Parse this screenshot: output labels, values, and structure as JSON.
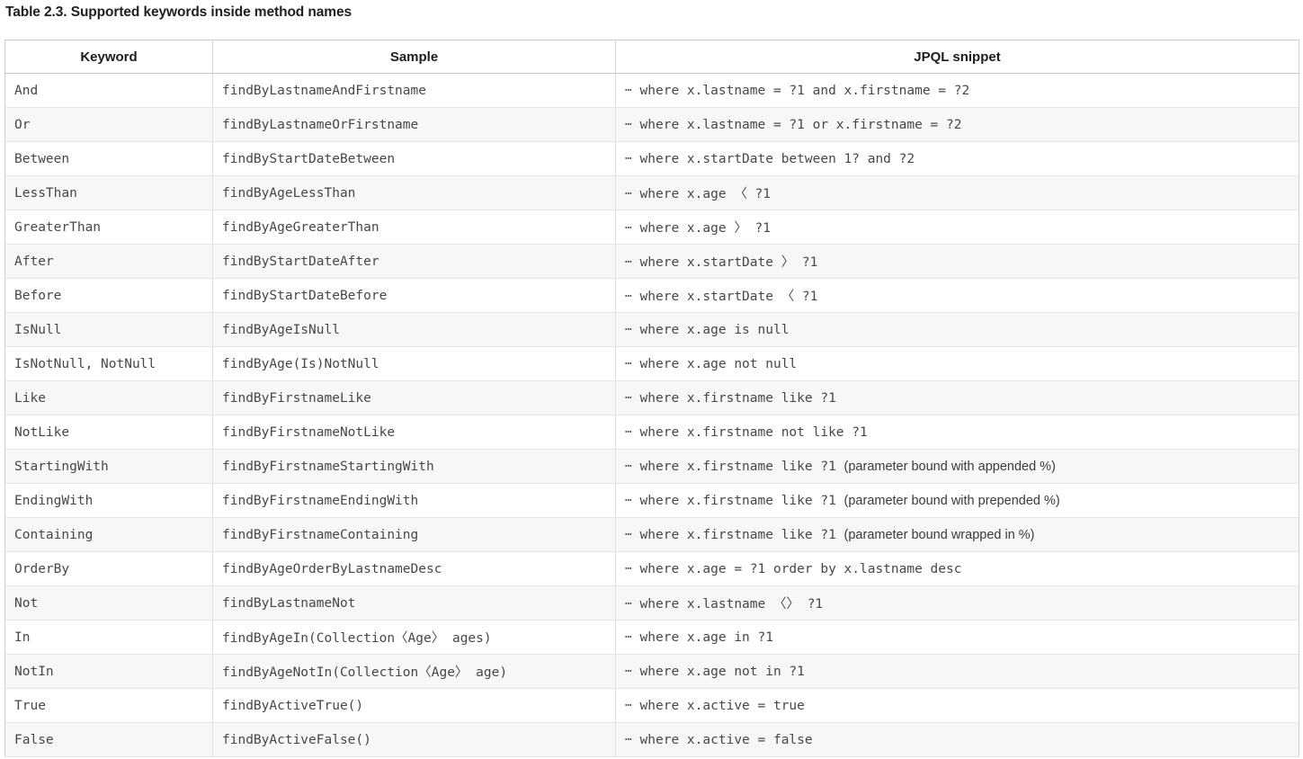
{
  "caption": "Table 2.3. Supported keywords inside method names",
  "table": {
    "columns": [
      {
        "key": "keyword",
        "label": "Keyword"
      },
      {
        "key": "sample",
        "label": "Sample"
      },
      {
        "key": "jpql",
        "label": "JPQL snippet"
      }
    ],
    "ellipsis": "⋯",
    "rows": [
      {
        "keyword": "And",
        "sample": "findByLastnameAndFirstname",
        "jpql_code": " where x.lastname = ?1 and x.firstname = ?2",
        "jpql_note": ""
      },
      {
        "keyword": "Or",
        "sample": "findByLastnameOrFirstname",
        "jpql_code": " where x.lastname = ?1 or x.firstname = ?2",
        "jpql_note": ""
      },
      {
        "keyword": "Between",
        "sample": "findByStartDateBetween",
        "jpql_code": " where x.startDate between 1? and ?2",
        "jpql_note": ""
      },
      {
        "keyword": "LessThan",
        "sample": "findByAgeLessThan",
        "jpql_code": " where x.age 〈 ?1",
        "jpql_note": ""
      },
      {
        "keyword": "GreaterThan",
        "sample": "findByAgeGreaterThan",
        "jpql_code": " where x.age 〉 ?1",
        "jpql_note": ""
      },
      {
        "keyword": "After",
        "sample": "findByStartDateAfter",
        "jpql_code": " where x.startDate 〉 ?1",
        "jpql_note": ""
      },
      {
        "keyword": "Before",
        "sample": "findByStartDateBefore",
        "jpql_code": " where x.startDate 〈 ?1",
        "jpql_note": ""
      },
      {
        "keyword": "IsNull",
        "sample": "findByAgeIsNull",
        "jpql_code": " where x.age is null",
        "jpql_note": ""
      },
      {
        "keyword": "IsNotNull, NotNull",
        "sample": "findByAge(Is)NotNull",
        "jpql_code": " where x.age not null",
        "jpql_note": ""
      },
      {
        "keyword": "Like",
        "sample": "findByFirstnameLike",
        "jpql_code": " where x.firstname like ?1",
        "jpql_note": ""
      },
      {
        "keyword": "NotLike",
        "sample": "findByFirstnameNotLike",
        "jpql_code": " where x.firstname not like ?1",
        "jpql_note": ""
      },
      {
        "keyword": "StartingWith",
        "sample": "findByFirstnameStartingWith",
        "jpql_code": " where x.firstname like ?1 ",
        "jpql_note": "(parameter bound with appended %)"
      },
      {
        "keyword": "EndingWith",
        "sample": "findByFirstnameEndingWith",
        "jpql_code": " where x.firstname like ?1 ",
        "jpql_note": "(parameter bound with prepended %)"
      },
      {
        "keyword": "Containing",
        "sample": "findByFirstnameContaining",
        "jpql_code": " where x.firstname like ?1 ",
        "jpql_note": "(parameter bound wrapped in %)"
      },
      {
        "keyword": "OrderBy",
        "sample": "findByAgeOrderByLastnameDesc",
        "jpql_code": " where x.age = ?1 order by x.lastname desc",
        "jpql_note": ""
      },
      {
        "keyword": "Not",
        "sample": "findByLastnameNot",
        "jpql_code": " where x.lastname 〈〉 ?1",
        "jpql_note": ""
      },
      {
        "keyword": "In",
        "sample": "findByAgeIn(Collection〈Age〉 ages)",
        "jpql_code": " where x.age in ?1",
        "jpql_note": ""
      },
      {
        "keyword": "NotIn",
        "sample": "findByAgeNotIn(Collection〈Age〉 age)",
        "jpql_code": " where x.age not in ?1",
        "jpql_note": ""
      },
      {
        "keyword": "True",
        "sample": "findByActiveTrue()",
        "jpql_code": " where x.active = true",
        "jpql_note": ""
      },
      {
        "keyword": "False",
        "sample": "findByActiveFalse()",
        "jpql_code": " where x.active = false",
        "jpql_note": ""
      }
    ]
  },
  "colors": {
    "text": "#2f2f2f",
    "code_text": "#44474d",
    "border": "#dddddd",
    "header_border": "#c6c6c6",
    "row_alt_bg": "#f7f7f7",
    "row_bg": "#ffffff"
  }
}
